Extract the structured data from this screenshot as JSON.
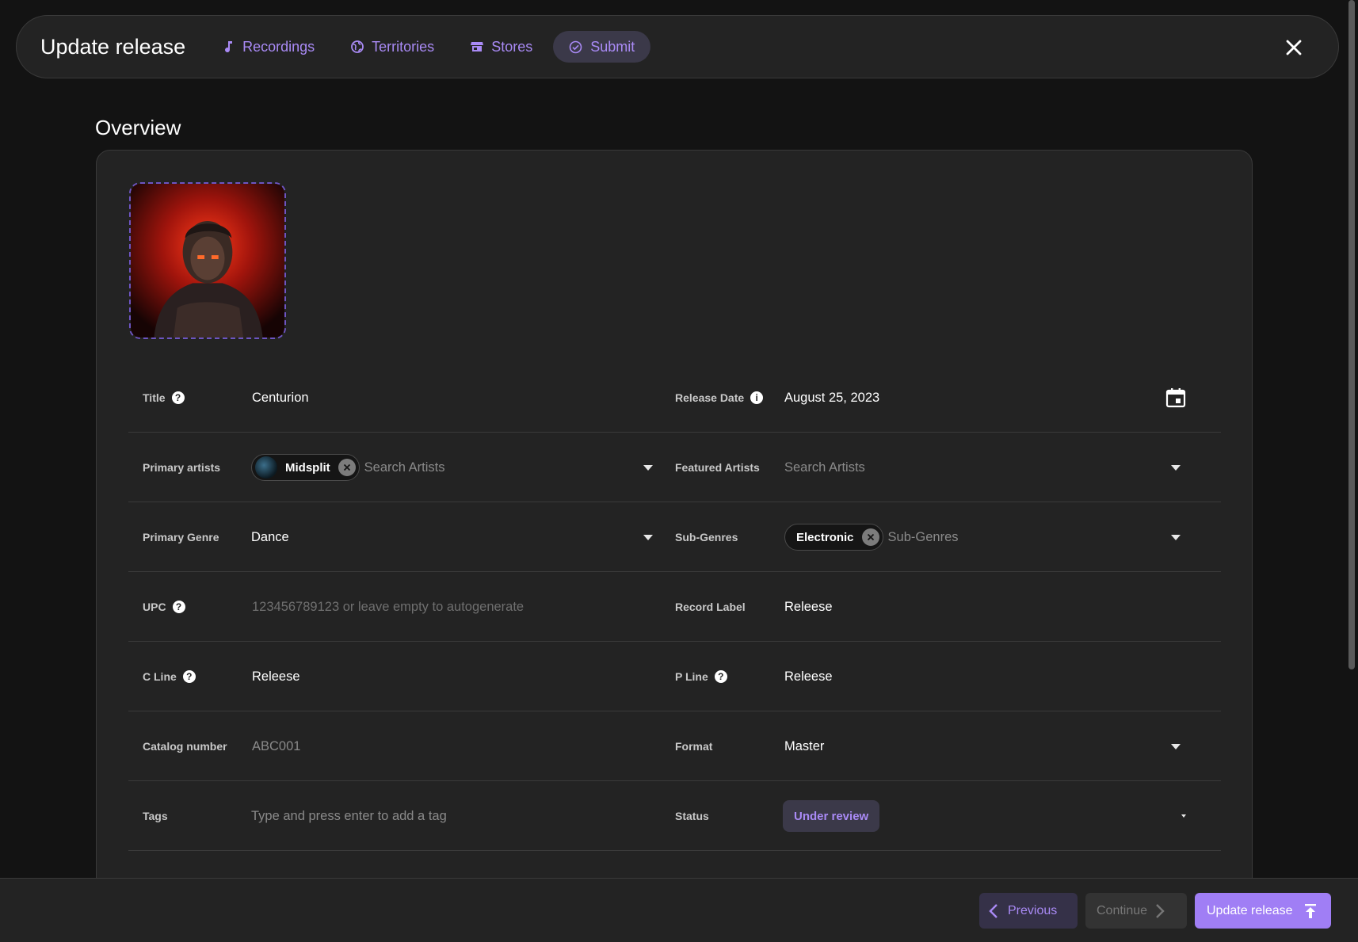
{
  "header": {
    "title": "Update release",
    "tabs": [
      {
        "label": "Recordings",
        "icon": "music-note-icon",
        "active": false
      },
      {
        "label": "Territories",
        "icon": "globe-icon",
        "active": false
      },
      {
        "label": "Stores",
        "icon": "store-icon",
        "active": false
      },
      {
        "label": "Submit",
        "icon": "check-circle-icon",
        "active": true
      }
    ]
  },
  "overview": {
    "title": "Overview",
    "fields": {
      "title": {
        "label": "Title",
        "value": "Centurion"
      },
      "release_date": {
        "label": "Release Date",
        "value": "August 25, 2023"
      },
      "primary_artists": {
        "label": "Primary artists",
        "chip": "Midsplit",
        "placeholder": "Search Artists"
      },
      "featured_artists": {
        "label": "Featured Artists",
        "placeholder": "Search Artists"
      },
      "primary_genre": {
        "label": "Primary Genre",
        "value": "Dance"
      },
      "sub_genres": {
        "label": "Sub-Genres",
        "chip": "Electronic",
        "placeholder": "Sub-Genres"
      },
      "upc": {
        "label": "UPC",
        "placeholder": "123456789123 or leave empty to autogenerate"
      },
      "record_label": {
        "label": "Record Label",
        "value": "Releese"
      },
      "c_line": {
        "label": "C Line",
        "value": "Releese"
      },
      "p_line": {
        "label": "P Line",
        "value": "Releese"
      },
      "catalog_number": {
        "label": "Catalog number",
        "placeholder": "ABC001"
      },
      "format": {
        "label": "Format",
        "value": "Master"
      },
      "tags": {
        "label": "Tags",
        "placeholder": "Type and press enter to add a tag"
      },
      "status": {
        "label": "Status",
        "value": "Under review"
      }
    }
  },
  "footer": {
    "previous": "Previous",
    "continue": "Continue",
    "update": "Update release"
  },
  "colors": {
    "accent": "#a07ef5",
    "accent_text": "#a98af5",
    "background": "#131313",
    "card": "#232323"
  }
}
